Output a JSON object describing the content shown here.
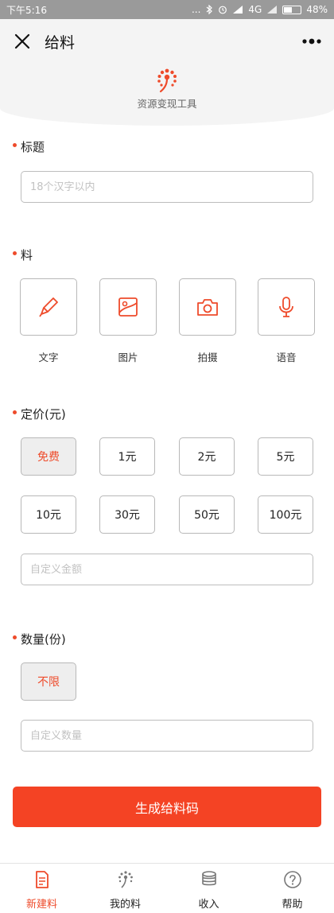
{
  "status_bar": {
    "time": "下午5:16",
    "signal_text": "...",
    "network": "4G",
    "battery": "48%",
    "battery_level": 0.48
  },
  "header": {
    "title": "给料",
    "close_icon": "close-icon",
    "more_icon": "more-dots-icon"
  },
  "hero": {
    "tagline": "资源变现工具",
    "logo_icon": "seed-logo-icon"
  },
  "title_section": {
    "label": "标题",
    "placeholder": "18个汉字以内",
    "value": ""
  },
  "content_section": {
    "label": "料",
    "tools": [
      {
        "label": "文字",
        "icon": "pen-icon"
      },
      {
        "label": "图片",
        "icon": "image-icon"
      },
      {
        "label": "拍摄",
        "icon": "camera-icon"
      },
      {
        "label": "语音",
        "icon": "microphone-icon"
      }
    ]
  },
  "price_section": {
    "label": "定价(元)",
    "options": [
      "免费",
      "1元",
      "2元",
      "5元",
      "10元",
      "30元",
      "50元",
      "100元"
    ],
    "selected": "免费",
    "custom_placeholder": "自定义金额"
  },
  "quantity_section": {
    "label": "数量(份)",
    "options": [
      "不限"
    ],
    "selected": "不限",
    "custom_placeholder": "自定义数量"
  },
  "submit_label": "生成给料码",
  "tabs": [
    {
      "label": "新建料",
      "icon": "document-icon",
      "active": true
    },
    {
      "label": "我的料",
      "icon": "seed-icon",
      "active": false
    },
    {
      "label": "收入",
      "icon": "coins-icon",
      "active": false
    },
    {
      "label": "帮助",
      "icon": "help-icon",
      "active": false
    }
  ],
  "colors": {
    "accent": "#ee4b2b",
    "button": "#f44324",
    "statusbar": "#9a9a9a"
  }
}
